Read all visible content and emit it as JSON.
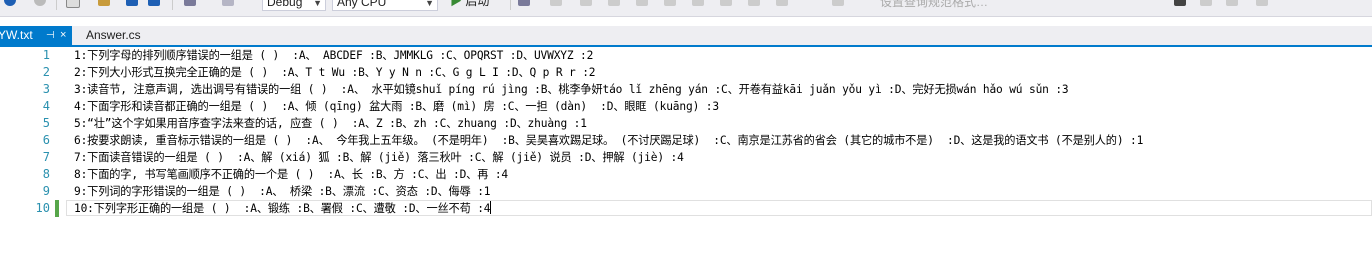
{
  "toolbar": {
    "config_label": "Debug",
    "platform_label": "Any CPU",
    "start_label": "启动",
    "search_hint": "设置查询规范格式…"
  },
  "tabs": [
    {
      "label": "YW.txt",
      "pin": "⊣",
      "close": "×",
      "active": true
    },
    {
      "label": "Answer.cs",
      "active": false
    }
  ],
  "editor": {
    "lines": [
      {
        "num": "1",
        "text": "1:下列字母的排列顺序错误的一组是 ( )  :A、 ABCDEF :B、JMMKLG :C、OPQRST :D、UVWXYZ :2"
      },
      {
        "num": "2",
        "text": "2:下列大小形式互换完全正确的是 ( )  :A、T t Wu :B、Y y N n :C、G g L I :D、Q p R r :2"
      },
      {
        "num": "3",
        "text": "3:读音节, 注意声调, 选出调号有错误的一组 ( )  :A、 水平如镜shuǐ píng rú jìng :B、桃李争妍táo lǐ zhēng yán :C、开卷有益kāi juǎn yǒu yì :D、完好无损wán hǎo wú sǔn :3"
      },
      {
        "num": "4",
        "text": "4:下面字形和读音都正确的一组是 ( )  :A、倾 (qīng) 盆大雨 :B、磨 (mì) 房 :C、一担 (dàn)  :D、眼眶 (kuāng) :3"
      },
      {
        "num": "5",
        "text": "5:“壮”这个字如果用音序查字法来查的话, 应查 ( )  :A、Z :B、zh :C、zhuang :D、zhuàng :1"
      },
      {
        "num": "6",
        "text": "6:按要求朗读, 重音标示错误的一组是 ( )  :A、 今年我上五年级。 (不是明年)  :B、吴昊喜欢踢足球。 (不讨厌踢足球)  :C、南京是江苏省的省会 (其它的城市不是)  :D、这是我的语文书 (不是别人的) :1"
      },
      {
        "num": "7",
        "text": "7:下面读音错误的一组是 ( )  :A、解 (xiá) 狐 :B、解 (jiě) 落三秋叶 :C、解 (jiě) 说员 :D、押解 (jiè) :4"
      },
      {
        "num": "8",
        "text": "8:下面的字, 书写笔画顺序不正确的一个是 ( )  :A、长 :B、方 :C、出 :D、再 :4"
      },
      {
        "num": "9",
        "text": "9:下列词的字形错误的一组是 ( )  :A、 桥梁 :B、漂流 :C、资态 :D、侮辱 :1"
      },
      {
        "num": "10",
        "text": "10:下列字形正确的一组是 ( )  :A、锻练 :B、署假 :C、遭敬 :D、一丝不苟 :4"
      }
    ]
  },
  "colors": {
    "accent": "#007acc",
    "line_number": "#2b91af",
    "change_marker": "#57a64a"
  }
}
